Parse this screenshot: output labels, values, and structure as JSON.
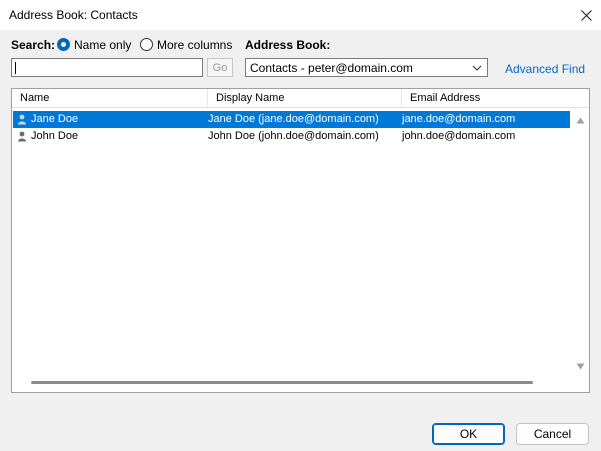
{
  "window": {
    "title": "Address Book: Contacts"
  },
  "search": {
    "label": "Search:",
    "options": [
      {
        "label": "Name only",
        "checked": true
      },
      {
        "label": "More columns",
        "checked": false
      }
    ],
    "input_value": "",
    "go_label": "Go"
  },
  "address_book": {
    "label": "Address Book:",
    "selected": "Contacts - peter@domain.com",
    "advanced_find": "Advanced Find"
  },
  "list": {
    "columns": [
      "Name",
      "Display Name",
      "Email Address"
    ],
    "rows": [
      {
        "name": "Jane Doe",
        "display_name": "Jane Doe (jane.doe@domain.com)",
        "email": "jane.doe@domain.com",
        "selected": true
      },
      {
        "name": "John Doe",
        "display_name": "John Doe (john.doe@domain.com)",
        "email": "john.doe@domain.com",
        "selected": false
      }
    ]
  },
  "buttons": {
    "ok": "OK",
    "cancel": "Cancel"
  },
  "icons": [
    "close-icon",
    "chevron-down-icon",
    "person-icon",
    "scroll-up-icon",
    "scroll-down-icon"
  ],
  "colors": {
    "accent": "#0067c0",
    "selection": "#0078d7",
    "link": "#0066cc"
  }
}
